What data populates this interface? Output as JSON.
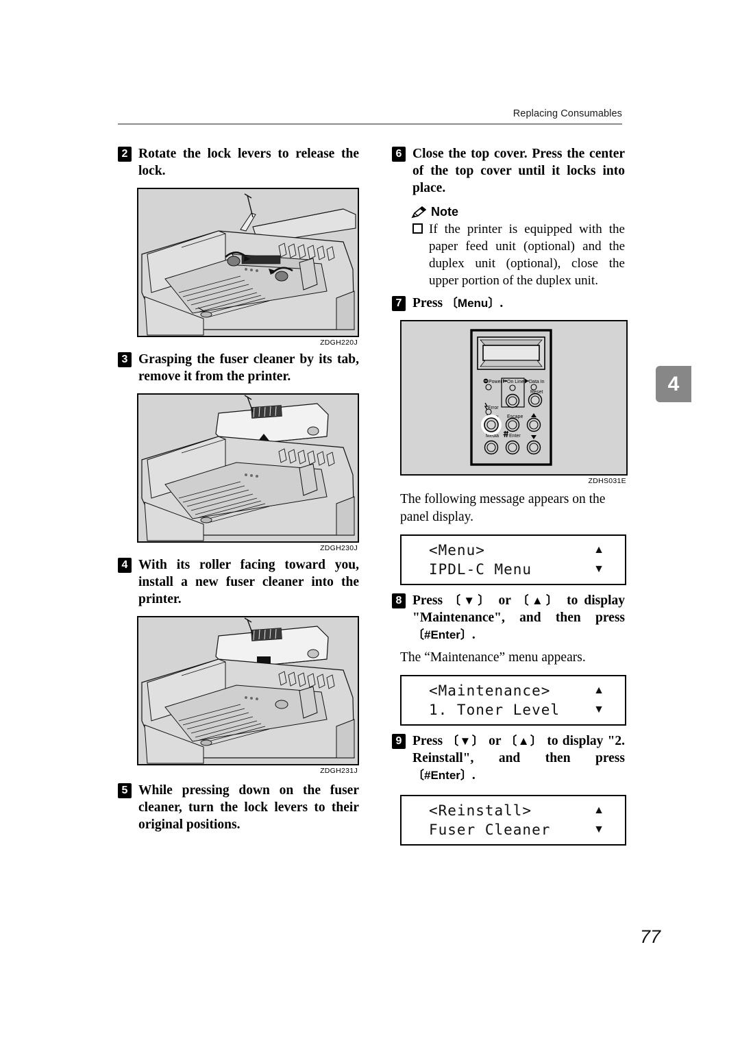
{
  "document": {
    "running_header": "Replacing Consumables",
    "chapter_tab": "4",
    "page_number": "77"
  },
  "left_column": {
    "steps": [
      {
        "number": "2",
        "text": "Rotate the lock levers to release the lock.",
        "figure_caption": "ZDGH220J",
        "figure_name": "printer-interior-rotate-lock-levers"
      },
      {
        "number": "3",
        "text": "Grasping the fuser cleaner by its tab, remove it from the printer.",
        "figure_caption": "ZDGH230J",
        "figure_name": "printer-interior-remove-fuser-cleaner"
      },
      {
        "number": "4",
        "text": "With its roller facing toward you, install a new fuser cleaner into the printer.",
        "figure_caption": "ZDGH231J",
        "figure_name": "printer-interior-install-fuser-cleaner"
      },
      {
        "number": "5",
        "text": "While pressing down on the fuser cleaner, turn the lock levers to their original positions.",
        "figure_caption": "",
        "figure_name": ""
      }
    ]
  },
  "right_column": {
    "step6": {
      "number": "6",
      "text": "Close the top cover. Press the center of the top cover until it locks into place."
    },
    "note": {
      "icon": "pencil-icon",
      "label": "Note",
      "bullet_icon": "square-bullet-icon",
      "text": "If the printer is equipped with the paper feed unit (optional) and the duplex unit (optional), close the upper portion of the duplex unit."
    },
    "step7": {
      "number": "7",
      "prefix": "Press ",
      "key": "Menu",
      "suffix": ".",
      "figure_caption": "ZDHS031E"
    },
    "control_panel": {
      "leds": [
        "Power",
        "On Line",
        "Data In",
        "Error"
      ],
      "buttons": [
        "On Line",
        "Reset",
        "Menu",
        "Escape",
        "▲",
        "Media",
        "#Enter",
        "▼"
      ],
      "power_label": "Power",
      "online_label": "On Line",
      "datain_label": "Data In",
      "reset_label": "Reset",
      "error_label": "Error",
      "menu_label": "Menu",
      "escape_label": "Escape",
      "up_label": "▲",
      "media_label": "Media",
      "enter_label": "Enter",
      "enter_hash": "#",
      "down_label": "▼"
    },
    "after_step7_text": "The following message appears on the panel display.",
    "lcd1": {
      "line1": "<Menu>",
      "line2": "IPDL-C Menu",
      "arrow_up": "▲",
      "arrow_down": "▼"
    },
    "step8": {
      "number": "8",
      "part1": "Press ",
      "key_down": "▼",
      "part2": " or ",
      "key_up": "▲",
      "part3": " to display \"Maintenance\", and then press ",
      "key_enter": "#Enter",
      "part4": "."
    },
    "after_step8_text": "The “Maintenance” menu appears.",
    "lcd2": {
      "line1": "<Maintenance>",
      "line2": "1. Toner Level",
      "arrow_up": "▲",
      "arrow_down": "▼"
    },
    "step9": {
      "number": "9",
      "part1": "Press ",
      "key_down": "▼",
      "part2": " or ",
      "key_up": "▲",
      "part3": " to display \"2. Reinstall\", and then press ",
      "key_enter": "#Enter",
      "part4": "."
    },
    "lcd3": {
      "line1": "<Reinstall>",
      "line2": "Fuser Cleaner",
      "arrow_up": "▲",
      "arrow_down": "▼"
    }
  },
  "colors": {
    "tab_gray": "#878787",
    "figure_gray": "#d4d4d4",
    "rule_gray": "#8a8a8a"
  }
}
